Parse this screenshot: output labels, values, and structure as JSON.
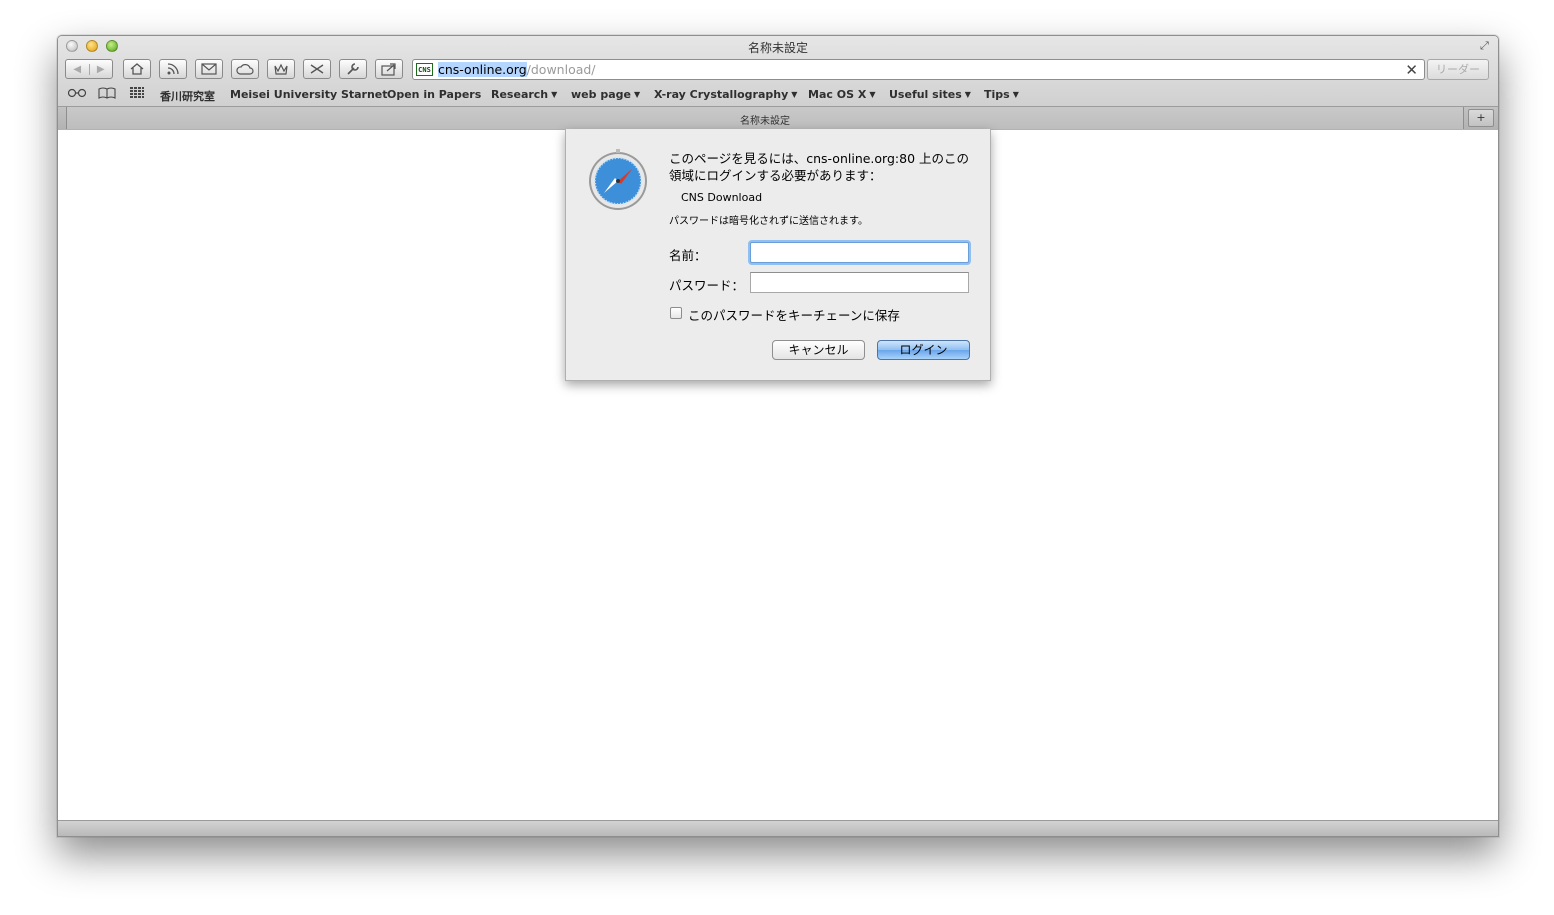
{
  "window": {
    "title": "名称未設定"
  },
  "toolbar": {
    "buttons": [
      "back-icon",
      "forward-icon",
      "home-icon",
      "rss-icon",
      "mail-icon",
      "cloud-icon",
      "crown-icon",
      "scissors-icon",
      "wrench-icon",
      "share-icon"
    ],
    "address": {
      "favicon_text": "CNS",
      "host": "cns-online.org",
      "path": "/download/"
    },
    "reader_label": "リーダー"
  },
  "bookmarks": {
    "icons": [
      "reading-list-icon",
      "bookmarks-book-icon",
      "top-sites-grid-icon"
    ],
    "items": [
      {
        "label": "香川研究室",
        "has_menu": false
      },
      {
        "label": "Meisei University Starnet",
        "has_menu": false
      },
      {
        "label": "Open in Papers",
        "has_menu": false
      },
      {
        "label": "Research",
        "has_menu": true
      },
      {
        "label": "web page",
        "has_menu": true
      },
      {
        "label": "X-ray Crystallography",
        "has_menu": true
      },
      {
        "label": "Mac OS X",
        "has_menu": true
      },
      {
        "label": "Useful sites",
        "has_menu": true
      },
      {
        "label": "Tips",
        "has_menu": true
      }
    ]
  },
  "tabs": {
    "active_title": "名称未設定",
    "new_tab_label": "+"
  },
  "dialog": {
    "message": "このページを見るには、cns-online.org:80 上のこの領域にログインする必要があります：",
    "realm": "CNS Download",
    "warning": "パスワードは暗号化されずに送信されます。",
    "name_label": "名前：",
    "password_label": "パスワード：",
    "name_value": "",
    "password_value": "",
    "remember_label": "このパスワードをキーチェーンに保存",
    "remember_checked": false,
    "cancel_label": "キャンセル",
    "login_label": "ログイン"
  },
  "colors": {
    "accent": "#6aa5ea",
    "selection": "#b4d5fe"
  }
}
